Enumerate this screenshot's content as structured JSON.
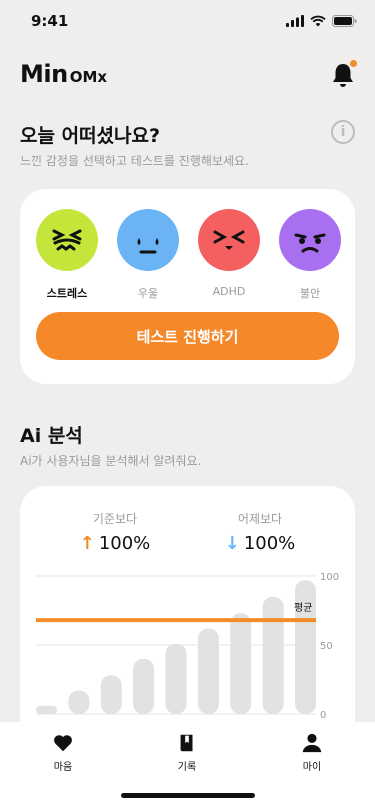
{
  "status": {
    "time": "9:41"
  },
  "header": {
    "logo_main": "Min",
    "logo_sub": "OMx"
  },
  "mood": {
    "title": "오늘 어떠셨나요?",
    "subtitle": "느낀 감정을 선택하고 테스트를 진행해보세요.",
    "emotions": [
      {
        "label": "스트레스",
        "color": "#c4e63a",
        "selected": true
      },
      {
        "label": "우울",
        "color": "#6ab4f5",
        "selected": false
      },
      {
        "label": "ADHD",
        "color": "#f46060",
        "selected": false
      },
      {
        "label": "불안",
        "color": "#a870f0",
        "selected": false
      }
    ],
    "button_label": "테스트 진행하기"
  },
  "ai": {
    "title": "Ai 분석",
    "subtitle": "Ai가 사용자님을 분석해서 알려줘요.",
    "compare_standard": {
      "label": "기준보다",
      "value": "100%",
      "direction": "up",
      "color": "#f28c28"
    },
    "compare_yesterday": {
      "label": "어제보다",
      "value": "100%",
      "direction": "down",
      "color": "#6ab4f5"
    }
  },
  "chart_data": {
    "type": "bar",
    "y_ticks": [
      "100",
      "50",
      "0"
    ],
    "ylim": [
      0,
      100
    ],
    "values": [
      6,
      17,
      28,
      40,
      51,
      62,
      73,
      85,
      97
    ],
    "average_label": "평균",
    "average_value": 68,
    "bar_color": "#e2e2e2",
    "average_color": "#f28c28"
  },
  "tabs": [
    {
      "label": "마음",
      "icon": "heart-icon"
    },
    {
      "label": "기록",
      "icon": "book-icon"
    },
    {
      "label": "마이",
      "icon": "person-icon"
    }
  ]
}
